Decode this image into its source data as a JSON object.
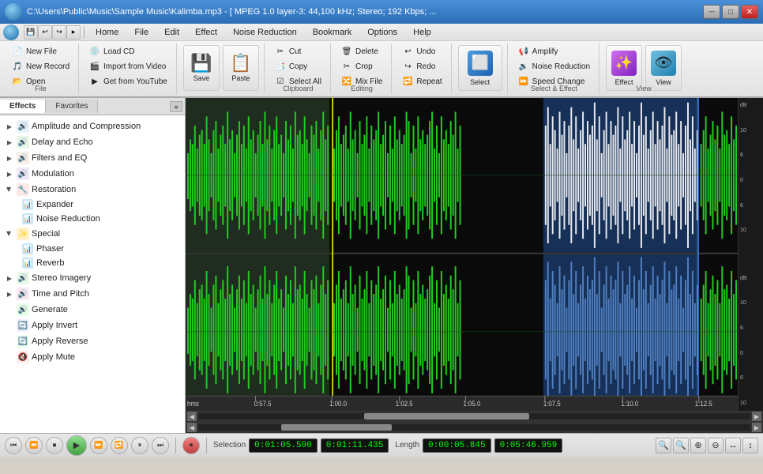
{
  "titlebar": {
    "title": "C:\\Users\\Public\\Music\\Sample Music\\Kalimba.mp3 - [ MPEG 1.0 layer-3: 44,100 kHz; Stereo; 192 Kbps; ...",
    "min_label": "─",
    "max_label": "□",
    "close_label": "✕"
  },
  "quicktoolbar": {
    "btns": [
      "💾",
      "↩",
      "↪",
      "▸"
    ]
  },
  "menubar": {
    "items": [
      "Home",
      "File",
      "Edit",
      "Effect",
      "Noise Reduction",
      "Bookmark",
      "Options",
      "Help"
    ]
  },
  "ribbon": {
    "groups": [
      {
        "label": "File",
        "buttons": [
          {
            "type": "small",
            "icon": "📄",
            "text": "New File"
          },
          {
            "type": "small",
            "icon": "🎵",
            "text": "New Record"
          },
          {
            "type": "small",
            "icon": "📂",
            "text": "Open"
          }
        ]
      },
      {
        "label": "File",
        "buttons": [
          {
            "type": "small",
            "icon": "💿",
            "text": "Load CD"
          },
          {
            "type": "small",
            "icon": "🎬",
            "text": "Import from Video"
          },
          {
            "type": "small",
            "icon": "▶",
            "text": "Get from YouTube"
          }
        ]
      },
      {
        "label": "",
        "big_buttons": [
          {
            "icon": "💾",
            "text": "Save"
          },
          {
            "icon": "📋",
            "text": "Paste"
          }
        ]
      },
      {
        "label": "Clipboard",
        "buttons": [
          {
            "type": "small",
            "icon": "✂",
            "text": "Cut"
          },
          {
            "type": "small",
            "icon": "📑",
            "text": "Copy"
          },
          {
            "type": "small",
            "icon": "☑",
            "text": "Select All"
          }
        ]
      },
      {
        "label": "Editing",
        "buttons": [
          {
            "type": "small",
            "icon": "🗑",
            "text": "Delete"
          },
          {
            "type": "small",
            "icon": "✂",
            "text": "Crop"
          },
          {
            "type": "small",
            "icon": "🔀",
            "text": "Mix File"
          }
        ]
      },
      {
        "label": "Editing",
        "buttons": [
          {
            "type": "small",
            "icon": "↩",
            "text": "Undo"
          },
          {
            "type": "small",
            "icon": "↪",
            "text": "Redo"
          },
          {
            "type": "small",
            "icon": "🔁",
            "text": "Repeat"
          }
        ]
      },
      {
        "label": "",
        "big_buttons": [
          {
            "icon": "🎯",
            "text": "Select"
          }
        ]
      },
      {
        "label": "Select & Effect",
        "buttons": [
          {
            "type": "small",
            "icon": "📢",
            "text": "Amplify"
          },
          {
            "type": "small",
            "icon": "🔉",
            "text": "Noise Reduction"
          },
          {
            "type": "small",
            "icon": "⏩",
            "text": "Speed Change"
          }
        ]
      },
      {
        "label": "",
        "big_buttons": [
          {
            "icon": "✨",
            "text": "Effect"
          }
        ]
      },
      {
        "label": "View",
        "big_buttons": [
          {
            "icon": "👁",
            "text": "View"
          }
        ]
      }
    ]
  },
  "sidebar": {
    "tabs": [
      "Effects",
      "Favorites"
    ],
    "tab_btn": "»",
    "tree": [
      {
        "label": "Amplitude and Compression",
        "icon": "🔊",
        "expandable": true,
        "expanded": false
      },
      {
        "label": "Delay and Echo",
        "icon": "🔊",
        "expandable": true,
        "expanded": false
      },
      {
        "label": "Filters and EQ",
        "icon": "🔊",
        "expandable": true,
        "expanded": false
      },
      {
        "label": "Modulation",
        "icon": "🔊",
        "expandable": true,
        "expanded": false
      },
      {
        "label": "Restoration",
        "icon": "🔧",
        "expandable": true,
        "expanded": true,
        "children": [
          {
            "label": "Expander",
            "icon": "📊"
          },
          {
            "label": "Noise Reduction",
            "icon": "📊"
          }
        ]
      },
      {
        "label": "Special",
        "icon": "✨",
        "expandable": true,
        "expanded": true,
        "children": [
          {
            "label": "Phaser",
            "icon": "📊"
          },
          {
            "label": "Reverb",
            "icon": "📊"
          }
        ]
      },
      {
        "label": "Stereo Imagery",
        "icon": "🔊",
        "expandable": true,
        "expanded": false
      },
      {
        "label": "Time and Pitch",
        "icon": "🔊",
        "expandable": true,
        "expanded": false
      },
      {
        "label": "Generate",
        "icon": "🔊",
        "expandable": false
      },
      {
        "label": "Apply Invert",
        "icon": "🔄",
        "expandable": false
      },
      {
        "label": "Apply Reverse",
        "icon": "🔄",
        "expandable": false
      },
      {
        "label": "Apply Mute",
        "icon": "🔇",
        "expandable": false
      }
    ]
  },
  "waveform": {
    "timeline_marks": [
      "hms",
      "0:57.5",
      "1:00.0",
      "1:02.5",
      "1:05.0",
      "1:07.5",
      "1:10.0",
      "1:12.5"
    ],
    "db_scale": [
      "dB",
      "10",
      "6",
      "0",
      "6",
      "10"
    ]
  },
  "statusbar": {
    "transport_btns": [
      "⏮",
      "⏪",
      "⏹",
      "▶",
      "⏩",
      "⏺",
      "⏸",
      "⏭"
    ],
    "record_btn": "⏺",
    "selection_label": "Selection",
    "selection_start": "0:01:05.590",
    "selection_end": "0:01:11.435",
    "length_label": "Length",
    "length_val": "0:00:05.845",
    "total_length": "0:05:46.959",
    "zoom_btns": [
      "🔍",
      "🔍",
      "⊕",
      "⊖",
      "↔",
      "↕"
    ]
  }
}
